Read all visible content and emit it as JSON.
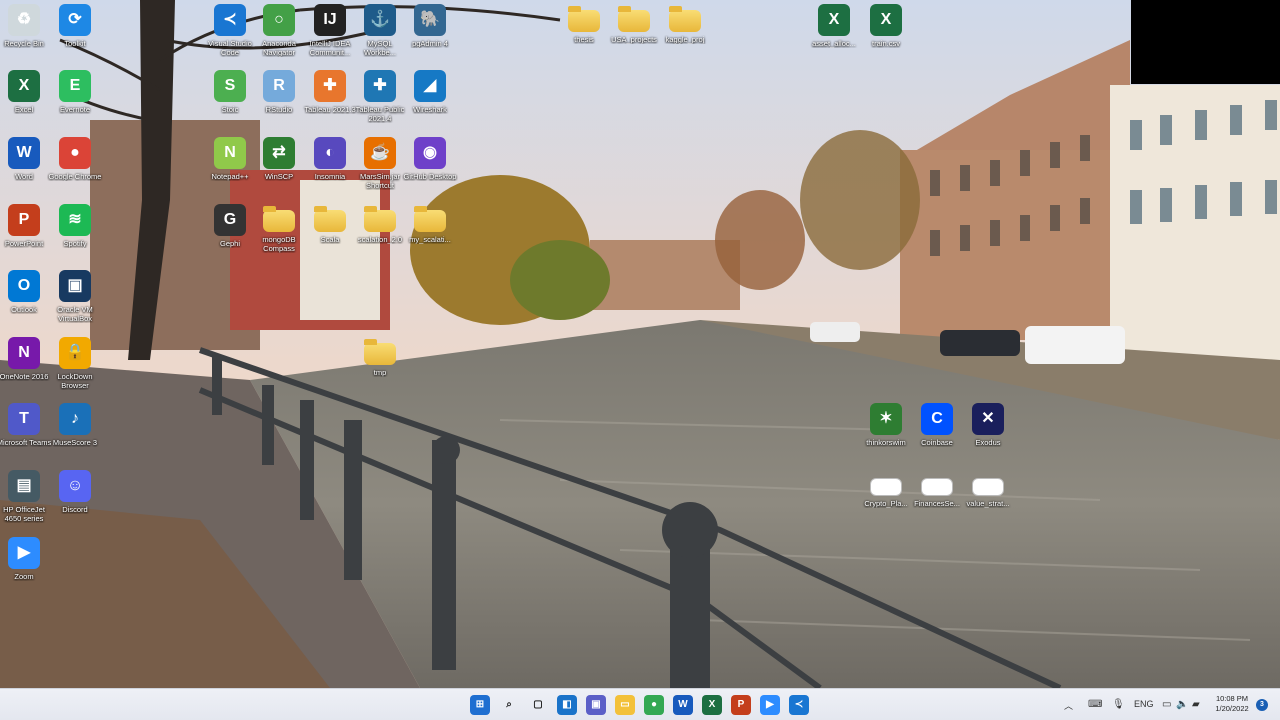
{
  "desktop_icons": [
    {
      "label": "Recycle Bin",
      "icon": "recycle-bin-icon",
      "color": "#cfd8dc",
      "glyph": "♻"
    },
    {
      "label": "Toolkit",
      "icon": "toolkit-icon",
      "color": "#1e88e5",
      "glyph": "⟳"
    },
    {
      "label": "Visual Studio Code",
      "icon": "vscode-icon",
      "color": "#1976d2",
      "glyph": "≺"
    },
    {
      "label": "Anaconda Navigator",
      "icon": "anaconda-icon",
      "color": "#43a047",
      "glyph": "○"
    },
    {
      "label": "IntelliJ IDEA Communit...",
      "icon": "intellij-icon",
      "color": "#222",
      "glyph": "IJ"
    },
    {
      "label": "MySQL Workbe...",
      "icon": "mysql-icon",
      "color": "#1e5b8a",
      "glyph": "⚓"
    },
    {
      "label": "pgAdmin 4",
      "icon": "pgadmin-icon",
      "color": "#336791",
      "glyph": "🐘"
    },
    {
      "label": "thesis",
      "icon": "folder-icon"
    },
    {
      "label": "USA_projects",
      "icon": "folder-icon"
    },
    {
      "label": "kaggle_proj",
      "icon": "folder-icon"
    },
    {
      "label": "asset_alloc...",
      "icon": "excel-file-icon",
      "color": "#1d6f42",
      "glyph": "X"
    },
    {
      "label": "train.csv",
      "icon": "excel-file-icon",
      "color": "#1d6f42",
      "glyph": "X"
    },
    {
      "label": "Excel",
      "icon": "excel-icon",
      "color": "#1d6f42",
      "glyph": "X"
    },
    {
      "label": "Evernote",
      "icon": "evernote-icon",
      "color": "#2dbe60",
      "glyph": "E"
    },
    {
      "label": "Stoic",
      "icon": "stoic-icon",
      "color": "#4caf50",
      "glyph": "S"
    },
    {
      "label": "RStudio",
      "icon": "rstudio-icon",
      "color": "#75aadb",
      "glyph": "R"
    },
    {
      "label": "Tableau 2021.3",
      "icon": "tableau-icon",
      "color": "#e8762d",
      "glyph": "✚"
    },
    {
      "label": "Tableau Public 2021.4",
      "icon": "tableau-public-icon",
      "color": "#1f77b4",
      "glyph": "✚"
    },
    {
      "label": "Wireshark",
      "icon": "wireshark-icon",
      "color": "#1679c5",
      "glyph": "◢"
    },
    {
      "label": "Word",
      "icon": "word-icon",
      "color": "#185abd",
      "glyph": "W"
    },
    {
      "label": "Google Chrome",
      "icon": "chrome-icon",
      "color": "#db4437",
      "glyph": "●"
    },
    {
      "label": "Notepad++",
      "icon": "notepadpp-icon",
      "color": "#90c94a",
      "glyph": "N"
    },
    {
      "label": "WinSCP",
      "icon": "winscp-icon",
      "color": "#2e7d32",
      "glyph": "⇄"
    },
    {
      "label": "Insomnia",
      "icon": "insomnia-icon",
      "color": "#5849be",
      "glyph": "◐"
    },
    {
      "label": "MarsSim.jar Shortcut",
      "icon": "java-icon",
      "color": "#e76f00",
      "glyph": "☕"
    },
    {
      "label": "GitHub Desktop",
      "icon": "github-icon",
      "color": "#6e40c9",
      "glyph": "◉"
    },
    {
      "label": "PowerPoint",
      "icon": "powerpoint-icon",
      "color": "#c43e1c",
      "glyph": "P"
    },
    {
      "label": "Spotify",
      "icon": "spotify-icon",
      "color": "#1db954",
      "glyph": "≋"
    },
    {
      "label": "Gephi",
      "icon": "gephi-icon",
      "color": "#333",
      "glyph": "G"
    },
    {
      "label": "mongoDB Compass",
      "icon": "folder-icon"
    },
    {
      "label": "Scala",
      "icon": "folder-icon"
    },
    {
      "label": "scalation_2.0",
      "icon": "folder-icon"
    },
    {
      "label": "my_scalati...",
      "icon": "folder-icon"
    },
    {
      "label": "Outlook",
      "icon": "outlook-icon",
      "color": "#0078d4",
      "glyph": "O"
    },
    {
      "label": "Oracle VM VirtualBox",
      "icon": "virtualbox-icon",
      "color": "#183a61",
      "glyph": "▣"
    },
    {
      "label": "OneNote 2016",
      "icon": "onenote-icon",
      "color": "#7719aa",
      "glyph": "N"
    },
    {
      "label": "LockDown Browser",
      "icon": "lockdown-browser-icon",
      "color": "#f2a900",
      "glyph": "🔒"
    },
    {
      "label": "tmp",
      "icon": "folder-icon"
    },
    {
      "label": "Microsoft Teams",
      "icon": "teams-icon",
      "color": "#5059c9",
      "glyph": "T"
    },
    {
      "label": "MuseScore 3",
      "icon": "musescore-icon",
      "color": "#1a70b8",
      "glyph": "♪"
    },
    {
      "label": "thinkorswim",
      "icon": "thinkorswim-icon",
      "color": "#2e7d32",
      "glyph": "✶"
    },
    {
      "label": "Coinbase",
      "icon": "coinbase-icon",
      "color": "#0052ff",
      "glyph": "C"
    },
    {
      "label": "Exodus",
      "icon": "exodus-icon",
      "color": "#1a1f5c",
      "glyph": "✕"
    },
    {
      "label": "HP OfficeJet 4650 series",
      "icon": "printer-icon",
      "color": "#455a64",
      "glyph": "▤"
    },
    {
      "label": "Discord",
      "icon": "discord-icon",
      "color": "#5865f2",
      "glyph": "☺"
    },
    {
      "label": "Crypto_Pla...",
      "icon": "document-icon"
    },
    {
      "label": "FinancesSe...",
      "icon": "document-icon"
    },
    {
      "label": "value_strat...",
      "icon": "document-icon"
    },
    {
      "label": "Zoom",
      "icon": "zoom-icon",
      "color": "#2d8cff",
      "glyph": "▶"
    }
  ],
  "taskbar": {
    "apps": [
      {
        "name": "start",
        "icon": "windows-start-icon",
        "color": "#1f6fd1",
        "glyph": "⊞"
      },
      {
        "name": "search",
        "icon": "search-icon",
        "color": "transparent",
        "glyph": "⌕"
      },
      {
        "name": "task-view",
        "icon": "task-view-icon",
        "color": "transparent",
        "glyph": "▢"
      },
      {
        "name": "widgets",
        "icon": "widgets-icon",
        "color": "#1a73c9",
        "glyph": "◧"
      },
      {
        "name": "chat",
        "icon": "chat-icon",
        "color": "#5b5fc7",
        "glyph": "▣"
      },
      {
        "name": "file-explorer",
        "icon": "file-explorer-icon",
        "color": "#f3c13a",
        "glyph": "▭"
      },
      {
        "name": "chrome",
        "icon": "chrome-icon",
        "color": "#34a853",
        "glyph": "●"
      },
      {
        "name": "word",
        "icon": "word-icon",
        "color": "#185abd",
        "glyph": "W"
      },
      {
        "name": "excel",
        "icon": "excel-icon",
        "color": "#1d6f42",
        "glyph": "X"
      },
      {
        "name": "powerpoint",
        "icon": "powerpoint-icon",
        "color": "#c43e1c",
        "glyph": "P"
      },
      {
        "name": "zoom",
        "icon": "zoom-icon",
        "color": "#2d8cff",
        "glyph": "▶"
      },
      {
        "name": "vscode",
        "icon": "vscode-icon",
        "color": "#1976d2",
        "glyph": "≺"
      }
    ],
    "tray": {
      "chevron": "︿",
      "language": "ENG",
      "time": "10:08 PM",
      "date": "1/20/2022",
      "notifications": "3"
    }
  }
}
